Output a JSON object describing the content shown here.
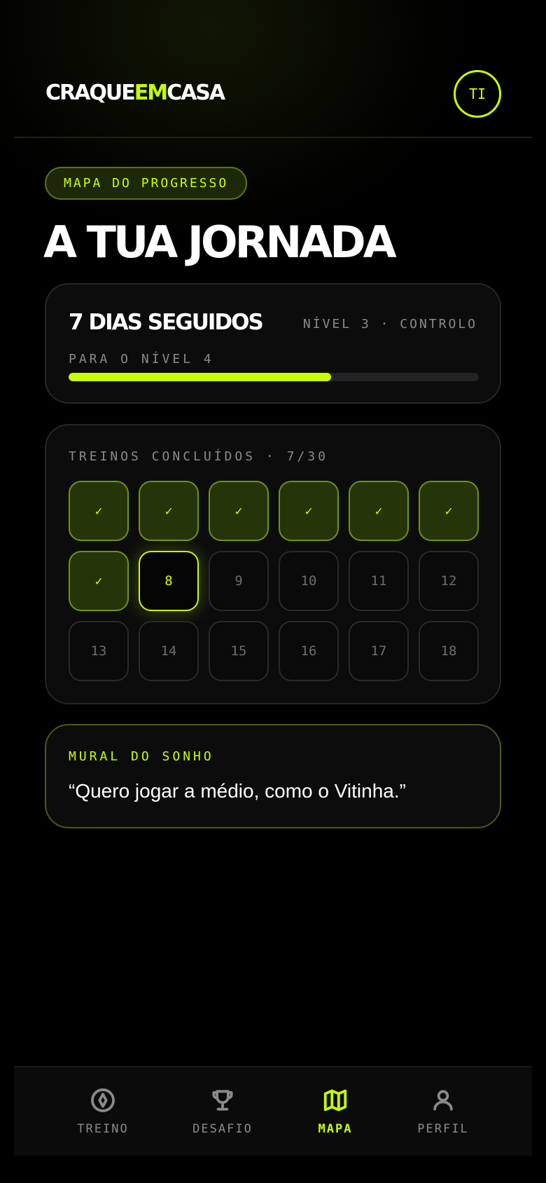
{
  "colors": {
    "accent": "#c8ff00",
    "background": "#000000",
    "muted": "#8a8a8a"
  },
  "header": {
    "logo_part1": "CRAQUE",
    "logo_part2": "EM",
    "logo_part3": "CASA",
    "avatar_initials": "TI"
  },
  "section": {
    "pill": "MAPA DO PROGRESSO",
    "title": "A TUA JORNADA"
  },
  "streak": {
    "title": "7 DIAS SEGUIDOS",
    "level": "NÍVEL 3 · CONTROLO",
    "next_level_label": "PARA O NÍVEL 4",
    "progress_percent": 64
  },
  "trainings": {
    "label": "TREINOS CONCLUÍDOS · 7/30",
    "cells": [
      {
        "text": "✓",
        "state": "done"
      },
      {
        "text": "✓",
        "state": "done"
      },
      {
        "text": "✓",
        "state": "done"
      },
      {
        "text": "✓",
        "state": "done"
      },
      {
        "text": "✓",
        "state": "done"
      },
      {
        "text": "✓",
        "state": "done"
      },
      {
        "text": "✓",
        "state": "done"
      },
      {
        "text": "8",
        "state": "current"
      },
      {
        "text": "9",
        "state": "locked"
      },
      {
        "text": "10",
        "state": "locked"
      },
      {
        "text": "11",
        "state": "locked"
      },
      {
        "text": "12",
        "state": "locked"
      },
      {
        "text": "13",
        "state": "locked"
      },
      {
        "text": "14",
        "state": "locked"
      },
      {
        "text": "15",
        "state": "locked"
      },
      {
        "text": "16",
        "state": "locked"
      },
      {
        "text": "17",
        "state": "locked"
      },
      {
        "text": "18",
        "state": "locked"
      }
    ]
  },
  "dream": {
    "label": "MURAL DO SONHO",
    "quote": "“Quero jogar a médio, como o Vitinha.”"
  },
  "nav": {
    "items": [
      {
        "label": "TREINO",
        "icon": "compass-icon",
        "active": false
      },
      {
        "label": "DESAFIO",
        "icon": "trophy-icon",
        "active": false
      },
      {
        "label": "MAPA",
        "icon": "map-icon",
        "active": true
      },
      {
        "label": "PERFIL",
        "icon": "user-icon",
        "active": false
      }
    ]
  }
}
